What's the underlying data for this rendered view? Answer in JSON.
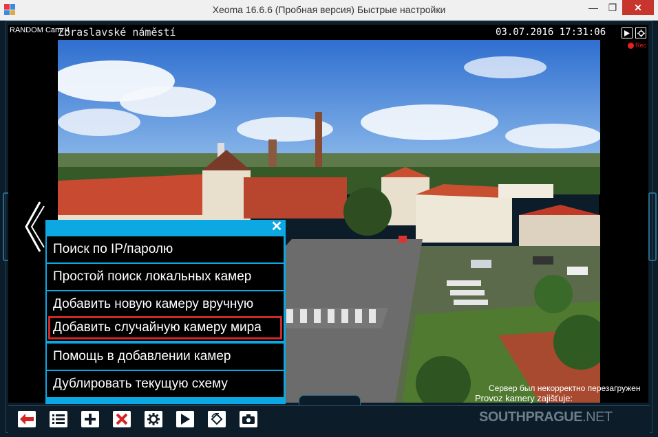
{
  "window": {
    "title": "Xeoma 16.6.6 (Пробная версия) Быстрые настройки",
    "min_glyph": "—",
    "max_glyph": "❐",
    "close_glyph": "✕"
  },
  "camera": {
    "name": "RANDOM Cam: 4",
    "place": "Zbraslavské náměstí",
    "timestamp": "03.07.2016 17:31:06",
    "rec_label": "Rec",
    "server_message": "Сервер был некорректно перезагружен",
    "provider": "Provoz kamery zajišťuje:",
    "brand_bold": "SOUTHPRAGUE",
    "brand_thin": ".NET"
  },
  "menu": {
    "close_glyph": "✕",
    "items": [
      {
        "label": "Поиск по IP/паролю"
      },
      {
        "label": "Простой поиск локальных камер"
      },
      {
        "label": "Добавить новую камеру вручную"
      },
      {
        "label": "Добавить случайную камеру мира",
        "highlighted": true
      },
      {
        "label": "Помощь в добавлении камер"
      },
      {
        "label": "Дублировать текущую схему"
      }
    ]
  },
  "toolbar": {
    "buttons": [
      "back-arrow-icon",
      "list-icon",
      "add-icon",
      "delete-icon",
      "settings-icon",
      "play-icon",
      "rotate-icon",
      "camera-icon"
    ]
  },
  "colors": {
    "accent": "#0ca8e4",
    "highlight": "#d32626",
    "background": "#0c1c29",
    "delete_red": "#d42424"
  }
}
